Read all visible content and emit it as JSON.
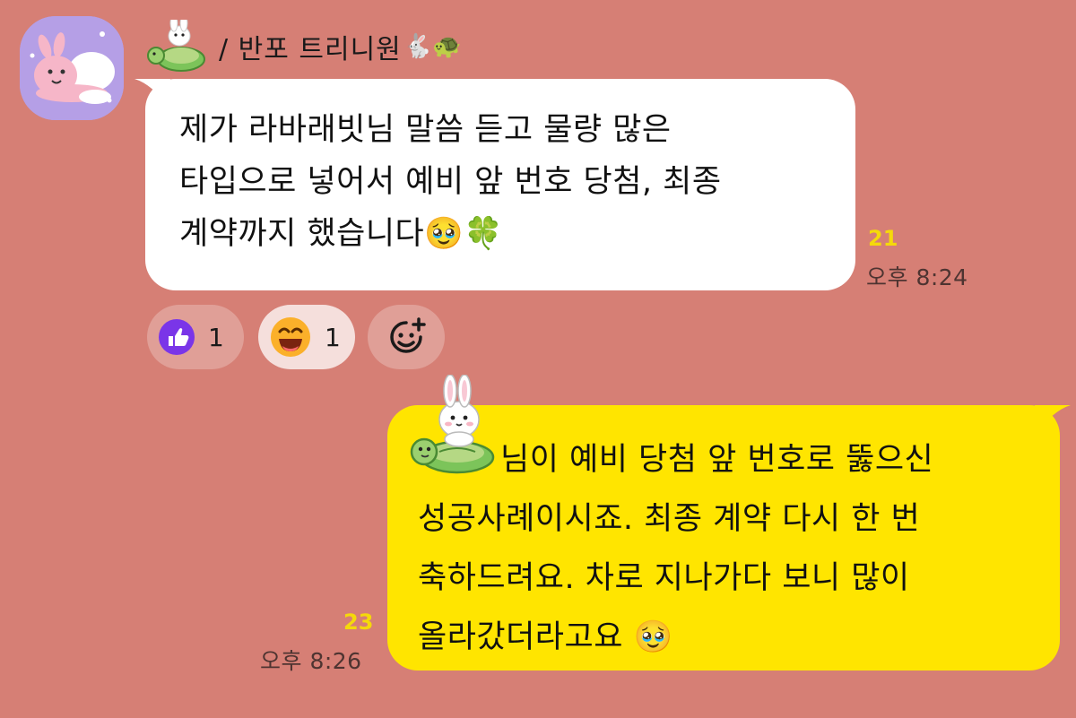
{
  "chat": {
    "sender": {
      "name": "/ 반포 트리니원",
      "name_emojis": "🐇🐢"
    },
    "incoming": {
      "lines": [
        "제가 라바래빗님 말씀 듣고 물량 많은",
        "타입으로 넣어서 예비 앞 번호 당첨, 최종",
        "계약까지 했습니다"
      ],
      "trailing_emojis": "🥹🍀",
      "unread": "21",
      "time": "오후 8:24"
    },
    "reactions": [
      {
        "icon": "thumbs-up-icon",
        "count": "1"
      },
      {
        "icon": "laughing-face-icon",
        "count": "1"
      },
      {
        "icon": "add-reaction-icon",
        "count": ""
      }
    ],
    "outgoing": {
      "lines": [
        "님이 예비 당첨 앞 번호로 뚫으신",
        "성공사례이시죠. 최종 계약 다시 한 번",
        "축하드려요. 차로 지나가다 보니 많이",
        "올라갔더라고요"
      ],
      "trailing_emoji": "🥹",
      "unread": "23",
      "time": "오후 8:26"
    },
    "colors": {
      "background": "#d67f75",
      "incoming_bubble": "#ffffff",
      "outgoing_bubble": "#ffe500",
      "unread": "#f5d90a",
      "avatar_bg": "#b59fe6"
    }
  }
}
